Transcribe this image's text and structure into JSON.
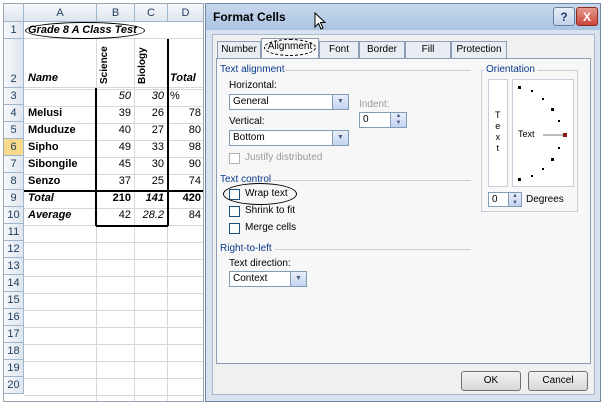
{
  "sheet": {
    "columns": [
      "A",
      "B",
      "C",
      "D"
    ],
    "rows": [
      "1",
      "2",
      "3",
      "4",
      "5",
      "6",
      "7",
      "8",
      "9",
      "10",
      "11",
      "12",
      "13",
      "14",
      "15",
      "16",
      "17",
      "18",
      "19",
      "20"
    ],
    "a1": "Grade 8 A Class Test",
    "headers": {
      "name": "Name",
      "science": "Science",
      "biology": "Biology",
      "total": "Total"
    },
    "row3": {
      "b": "50",
      "c": "30",
      "d": "%"
    },
    "students": [
      {
        "name": "Melusi",
        "b": "39",
        "c": "26",
        "d": "78"
      },
      {
        "name": "Mduduze",
        "b": "40",
        "c": "27",
        "d": "80"
      },
      {
        "name": "Sipho",
        "b": "49",
        "c": "33",
        "d": "98"
      },
      {
        "name": "Sibongile",
        "b": "45",
        "c": "30",
        "d": "90"
      },
      {
        "name": "Senzo",
        "b": "37",
        "c": "25",
        "d": "74"
      }
    ],
    "total_row": {
      "name": "Total",
      "b": "210",
      "c": "141",
      "d": "420"
    },
    "average_row": {
      "name": "Average",
      "b": "42",
      "c": "28.2",
      "d": "84"
    },
    "selected_row": "6"
  },
  "dialog": {
    "title": "Format Cells",
    "help": "?",
    "close": "X",
    "tabs": [
      "Number",
      "Alignment",
      "Font",
      "Border",
      "Fill",
      "Protection"
    ],
    "active_tab": "Alignment",
    "text_alignment": {
      "group": "Text alignment",
      "horizontal_label": "Horizontal:",
      "horizontal_value": "General",
      "indent_label": "Indent:",
      "indent_value": "0",
      "vertical_label": "Vertical:",
      "vertical_value": "Bottom",
      "justify": "Justify distributed"
    },
    "text_control": {
      "group": "Text control",
      "wrap": "Wrap text",
      "shrink": "Shrink to fit",
      "merge": "Merge cells"
    },
    "rtl": {
      "group": "Right-to-left",
      "direction_label": "Text direction:",
      "direction_value": "Context"
    },
    "orientation": {
      "group": "Orientation",
      "vertical_text": [
        "T",
        "e",
        "x",
        "t"
      ],
      "dial_text": "Text",
      "degrees_value": "0",
      "degrees_label": "Degrees"
    },
    "ok": "OK",
    "cancel": "Cancel"
  },
  "colors": {
    "accent": "#0a3a8c",
    "selected_row": "#f9d98a",
    "close_button": "#c9463d"
  }
}
